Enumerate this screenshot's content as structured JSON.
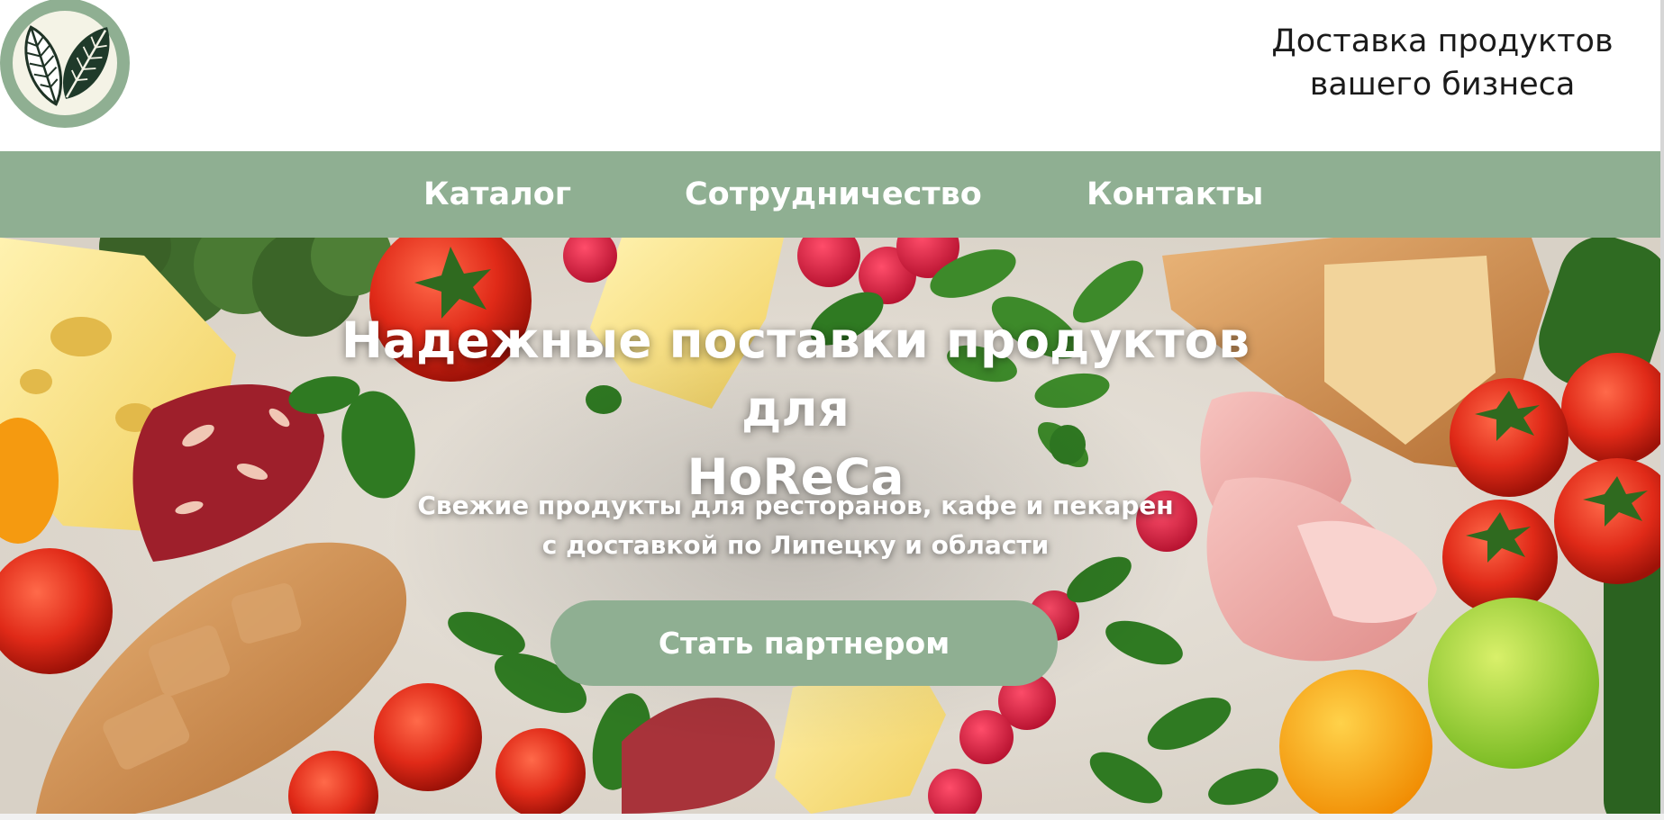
{
  "header": {
    "logo_icon": "leaf-logo-icon",
    "tagline_line1": "Доставка продуктов",
    "tagline_line2": "вашего бизнеса"
  },
  "nav": {
    "items": [
      {
        "label": "Каталог"
      },
      {
        "label": "Сотрудничество"
      },
      {
        "label": "Контакты"
      }
    ]
  },
  "hero": {
    "title_line1": "Надежные поставки продуктов для",
    "title_line2": "HoReCa",
    "subtitle_line1": "Свежие продукты для ресторанов, кафе и пекарен",
    "subtitle_line2": "с доставкой по Липецку и области",
    "cta_label": "Стать партнером"
  },
  "colors": {
    "accent": "#8faf92",
    "text_dark": "#1b1b1b",
    "white": "#ffffff"
  }
}
